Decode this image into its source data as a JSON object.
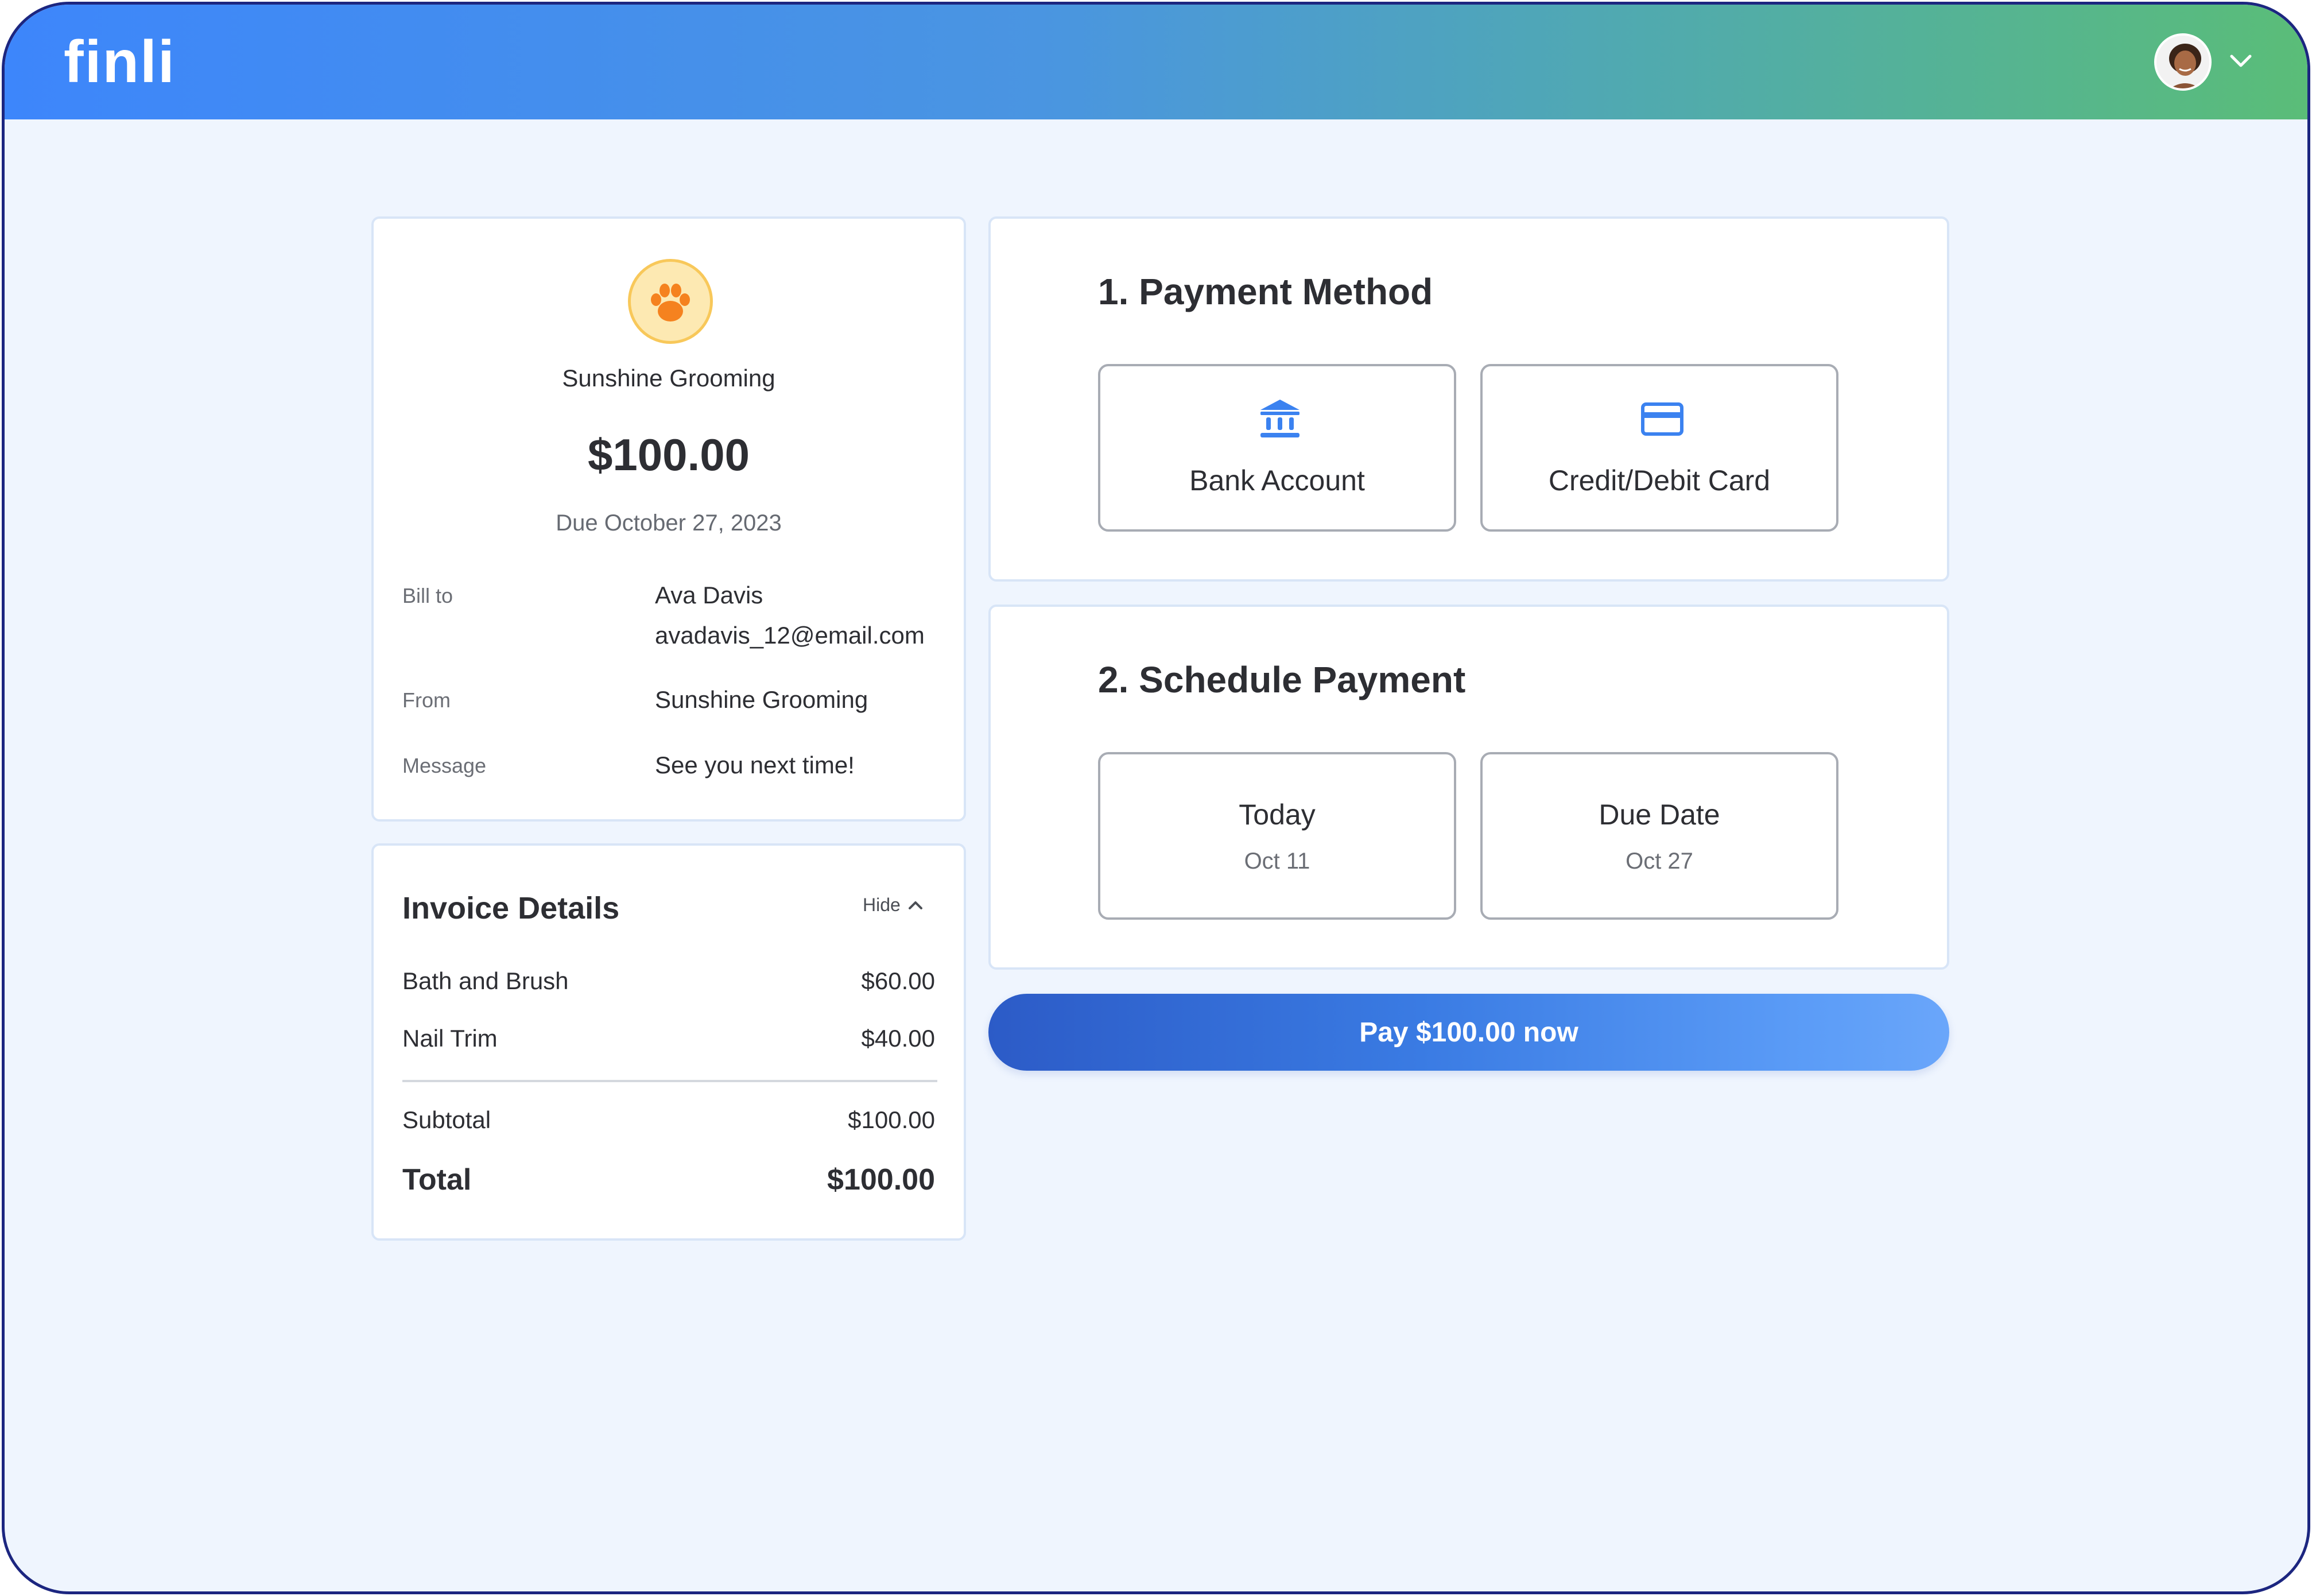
{
  "header": {
    "logo_text": "finli",
    "avatar_icon": "user-avatar",
    "menu_icon": "chevron-down-icon"
  },
  "summary": {
    "merchant_icon": "paw-icon",
    "merchant_name": "Sunshine Grooming",
    "amount": "$100.00",
    "due": "Due October 27, 2023",
    "bill_to_label": "Bill to",
    "bill_to_name": "Ava Davis",
    "bill_to_email": "avadavis_12@email.com",
    "from_label": "From",
    "from_value": "Sunshine Grooming",
    "message_label": "Message",
    "message_value": "See you next time!"
  },
  "invoice_details": {
    "title": "Invoice Details",
    "toggle_label": "Hide",
    "items": [
      {
        "label": "Bath and Brush",
        "amount": "$60.00"
      },
      {
        "label": "Nail Trim",
        "amount": "$40.00"
      }
    ],
    "subtotal_label": "Subtotal",
    "subtotal_value": "$100.00",
    "total_label": "Total",
    "total_value": "$100.00"
  },
  "payment_method": {
    "title": "1. Payment Method",
    "options": [
      {
        "label": "Bank Account",
        "icon": "bank-icon"
      },
      {
        "label": "Credit/Debit Card",
        "icon": "credit-card-icon"
      }
    ]
  },
  "schedule": {
    "title": "2. Schedule Payment",
    "options": [
      {
        "label": "Today",
        "date": "Oct 11"
      },
      {
        "label": "Due Date",
        "date": "Oct 27"
      }
    ]
  },
  "pay_button": {
    "label": "Pay $100.00 now"
  },
  "colors": {
    "brand_blue": "#3d86fb",
    "brand_green": "#5abd78",
    "page_bg": "#eff5fe",
    "icon_blue": "#3b82f0",
    "paw_orange": "#f5821f",
    "frame_border": "#1c2680"
  }
}
